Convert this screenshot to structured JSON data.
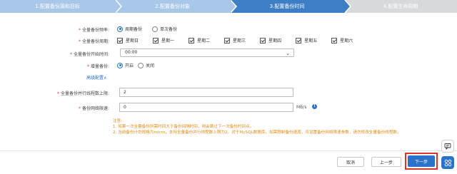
{
  "steps": [
    {
      "label": "1.配置备份源和目标"
    },
    {
      "label": "2.配置备份对象"
    },
    {
      "label": "3.配置备份时间"
    },
    {
      "label": "4.配置生命周期"
    }
  ],
  "form": {
    "full_backup_freq": {
      "label": "全量备份频率:",
      "options": [
        "周期备份",
        "单次备份"
      ],
      "selected": "周期备份"
    },
    "full_backup_period": {
      "label": "全量备份周期:",
      "days": [
        "星期日",
        "星期一",
        "星期二",
        "星期三",
        "星期四",
        "星期五",
        "星期六"
      ]
    },
    "full_backup_start": {
      "label": "全量备份开始时间:",
      "value": "00:00"
    },
    "incremental": {
      "label": "增量备份:",
      "options": [
        "开启",
        "关闭"
      ],
      "selected": "开启"
    },
    "advanced": {
      "label": "高级配置∧"
    },
    "parallel_limit": {
      "label": "全量备份并行线程数上限:",
      "value": "2"
    },
    "net_speed": {
      "label": "备份网络限速:",
      "value": "0",
      "unit": "MB/s"
    }
  },
  "notes": {
    "title": "注意:",
    "line1": "1. 如果一次全量备份所需时间大于备份间隔时间，则会跳过下一次备份时间点。",
    "line2": "2. 当前备份计划规格为micro，支持全量备份并行线程数上限为2。对于MySQL数据库，如需限制备份速度，可设置备份网络限速参数，请勿修改全量备份线程数。"
  },
  "footer": {
    "cancel": "取消",
    "prev": "上一步",
    "next": "下一步"
  },
  "colors": {
    "active_step": "#3d7fc6",
    "done_step": "#a9c7e8",
    "pending_step": "#d7d9db",
    "primary": "#2a73c9",
    "warning_text": "#e08a17",
    "highlight_border": "#d9362b"
  },
  "icons": {
    "chevron": "chevron-down-icon",
    "info": "info-icon",
    "chat": "chat-icon",
    "grid": "grid-icon"
  }
}
